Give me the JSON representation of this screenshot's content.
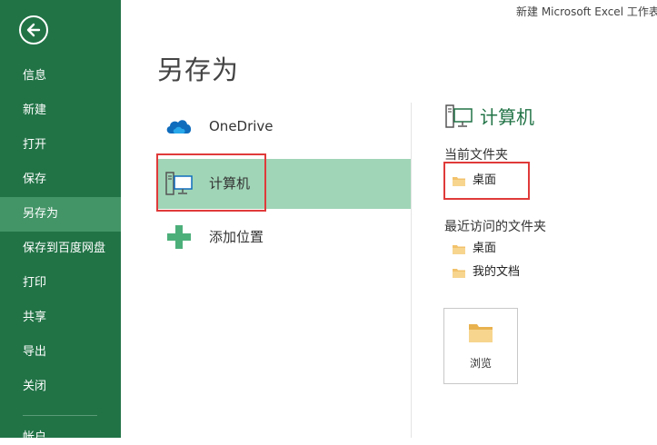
{
  "window": {
    "title": "新建 Microsoft Excel 工作表"
  },
  "sidebar": {
    "items": [
      {
        "label": "信息"
      },
      {
        "label": "新建"
      },
      {
        "label": "打开"
      },
      {
        "label": "保存"
      },
      {
        "label": "另存为",
        "active": true
      },
      {
        "label": "保存到百度网盘"
      },
      {
        "label": "打印"
      },
      {
        "label": "共享"
      },
      {
        "label": "导出"
      },
      {
        "label": "关闭"
      }
    ],
    "cut_off_item": "帐户"
  },
  "page": {
    "title": "另存为"
  },
  "locations": [
    {
      "label": "OneDrive",
      "icon": "cloud-icon"
    },
    {
      "label": "计算机",
      "icon": "computer-icon",
      "selected": true
    },
    {
      "label": "添加位置",
      "icon": "plus-icon"
    }
  ],
  "right_panel": {
    "title": "计算机",
    "current_folder_label": "当前文件夹",
    "current_folder": "桌面",
    "recent_label": "最近访问的文件夹",
    "recent": [
      "桌面",
      "我的文档"
    ],
    "browse_label": "浏览"
  },
  "colors": {
    "sidebar": "#217346",
    "sidebar_active": "#439467",
    "selected": "#a0d5b7",
    "highlight": "#e03a3a",
    "folder": "#f2c26b"
  }
}
